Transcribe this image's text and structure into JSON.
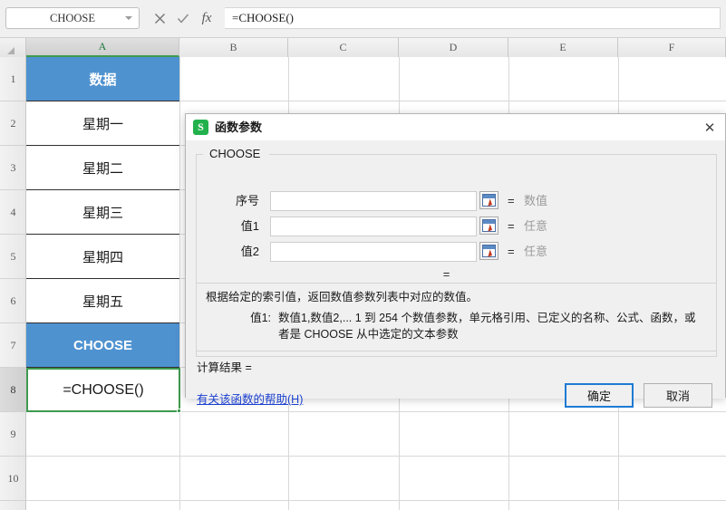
{
  "formula_bar": {
    "name_box_value": "CHOOSE",
    "cancel_icon": "close-icon",
    "confirm_icon": "check-icon",
    "fx_label": "fx",
    "formula_value": "=CHOOSE()"
  },
  "sheet": {
    "columns": [
      "A",
      "B",
      "C",
      "D",
      "E",
      "F"
    ],
    "selected_column": "A",
    "rows": [
      "1",
      "2",
      "3",
      "4",
      "5",
      "6",
      "7",
      "8",
      "9",
      "10"
    ],
    "selected_row": "8",
    "cells": [
      {
        "ref": "A1",
        "value": "数据",
        "style": "header-blue"
      },
      {
        "ref": "A2",
        "value": "星期一",
        "style": "data"
      },
      {
        "ref": "A3",
        "value": "星期二",
        "style": "data"
      },
      {
        "ref": "A4",
        "value": "星期三",
        "style": "data"
      },
      {
        "ref": "A5",
        "value": "星期四",
        "style": "data"
      },
      {
        "ref": "A6",
        "value": "星期五",
        "style": "data"
      },
      {
        "ref": "A7",
        "value": "CHOOSE",
        "style": "header-blue"
      }
    ],
    "active_cell": {
      "ref": "A8",
      "value": "=CHOOSE()"
    }
  },
  "dialog": {
    "title": "函数参数",
    "logo_text": "S",
    "close_label": "✕",
    "function_name": "CHOOSE",
    "args": [
      {
        "label": "序号",
        "value": "",
        "eq": "=",
        "type": "数值",
        "picker_icon": "range-select-icon"
      },
      {
        "label": "值1",
        "value": "",
        "eq": "=",
        "type": "任意",
        "picker_icon": "range-select-icon"
      },
      {
        "label": "值2",
        "value": "",
        "eq": "=",
        "type": "任意",
        "picker_icon": "range-select-icon"
      }
    ],
    "result_eq": "=",
    "description": "根据给定的索引值，返回数值参数列表中对应的数值。",
    "arg_help_label": "值1:",
    "arg_help_text": "数值1,数值2,... 1 到 254 个数值参数，单元格引用、已定义的名称、公式、函数，或者是 CHOOSE 从中选定的文本参数",
    "calc_result_label": "计算结果  =",
    "help_link": "有关该函数的帮助(H)",
    "ok_label": "确定",
    "cancel_label": "取消"
  },
  "colors": {
    "header_blue": "#4f92d0",
    "selection_green": "#3f9a4f",
    "accent_blue": "#1e7bd4",
    "link_blue": "#1a3fd0",
    "logo_green": "#22b14c"
  }
}
